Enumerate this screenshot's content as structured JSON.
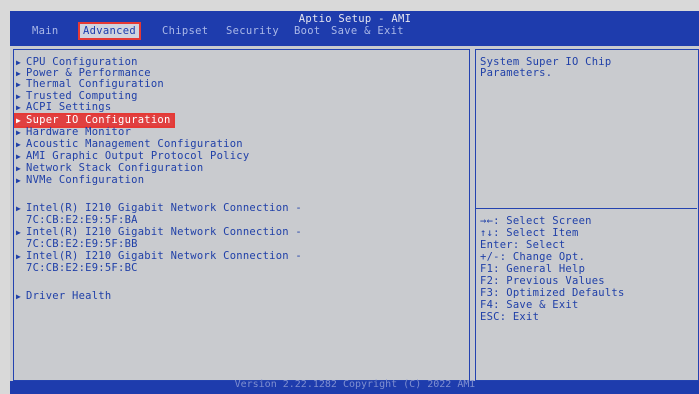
{
  "title": "Aptio Setup - AMI",
  "tabs": [
    "Main",
    "Advanced",
    "Chipset",
    "Security",
    "Boot",
    "Save & Exit"
  ],
  "active_tab": "Advanced",
  "menu_items": [
    "CPU Configuration",
    "Power & Performance",
    "Thermal Configuration",
    "Trusted Computing",
    "ACPI Settings",
    "Super IO Configuration",
    "Hardware Monitor",
    "Acoustic Management Configuration",
    "AMI Graphic Output Protocol Policy",
    "Network Stack Configuration",
    "NVMe Configuration"
  ],
  "selected_item": "Super IO Configuration",
  "network_items": [
    {
      "line1": "Intel(R) I210 Gigabit  Network Connection -",
      "line2": "7C:CB:E2:E9:5F:BA"
    },
    {
      "line1": "Intel(R) I210 Gigabit  Network Connection -",
      "line2": "7C:CB:E2:E9:5F:BB"
    },
    {
      "line1": "Intel(R) I210 Gigabit  Network Connection -",
      "line2": "7C:CB:E2:E9:5F:BC"
    }
  ],
  "driver_health": "Driver Health",
  "help_text": [
    "System Super IO Chip",
    "Parameters."
  ],
  "key_help": [
    "→←: Select Screen",
    "↑↓: Select Item",
    "Enter: Select",
    "+/-: Change Opt.",
    "F1: General Help",
    "F2: Previous Values",
    "F3: Optimized Defaults",
    "F4: Save & Exit",
    "ESC: Exit"
  ],
  "footer": "Version 2.22.1282 Copyright (C) 2022 AMI",
  "colors": {
    "bios_blue": "#1e3cad",
    "text_blue": "#2040a8",
    "highlight": "#e53935"
  },
  "icons": {
    "menu_arrow": "right-triangle-icon"
  }
}
